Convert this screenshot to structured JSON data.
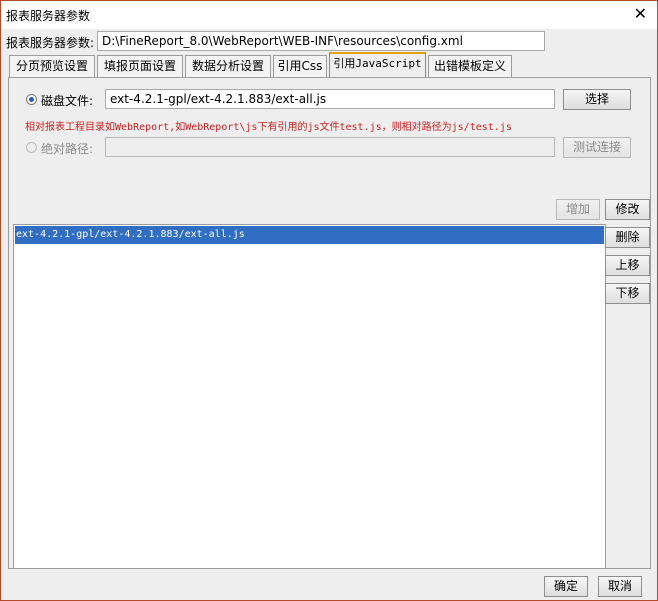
{
  "window": {
    "title": "报表服务器参数",
    "close_symbol": "✕"
  },
  "config": {
    "label": "报表服务器参数:",
    "path": "D:\\FineReport_8.0\\WebReport\\WEB-INF\\resources\\config.xml"
  },
  "tabs": [
    {
      "label": "分页预览设置"
    },
    {
      "label": "填报页面设置"
    },
    {
      "label": "数据分析设置"
    },
    {
      "label": "引用Css"
    },
    {
      "label": "引用JavaScript"
    },
    {
      "label": "出错模板定义"
    }
  ],
  "disk_file": {
    "label": "磁盘文件:",
    "value": "ext-4.2.1-gpl/ext-4.2.1.883/ext-all.js",
    "button": "选择",
    "selected": true
  },
  "hint": "相对报表工程目录如WebReport,如WebReport\\js下有引用的js文件test.js，则相对路径为js/test.js",
  "absolute_path": {
    "label": "绝对路径:",
    "value": "",
    "button": "测试连接"
  },
  "actions": {
    "add": "增加",
    "edit": "修改",
    "delete": "删除",
    "up": "上移",
    "down": "下移"
  },
  "list_items": [
    "ext-4.2.1-gpl/ext-4.2.1.883/ext-all.js"
  ],
  "footer": {
    "ok": "确定",
    "cancel": "取消"
  }
}
